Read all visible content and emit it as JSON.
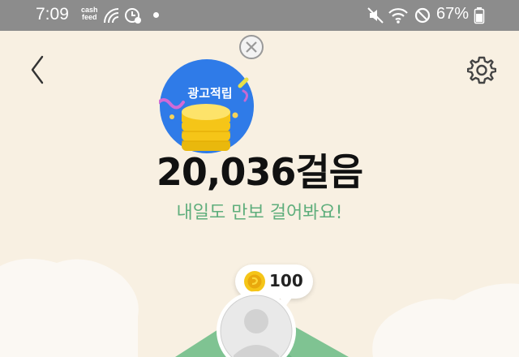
{
  "status_bar": {
    "time": "7:09",
    "cashfeed_top": "cash",
    "cashfeed_bottom": "feed",
    "battery": "67%"
  },
  "header": {
    "back_icon": "chevron-left-icon",
    "settings_icon": "gear-icon",
    "close_icon": "close-circle-icon"
  },
  "ad_badge": {
    "label": "광고적립"
  },
  "steps": {
    "count_text": "20,036걸음",
    "message": "내일도 만보 걸어봐요!"
  },
  "reward": {
    "amount": "100",
    "icon": "coin-icon"
  },
  "colors": {
    "background": "#f8f0e2",
    "accent_green": "#5fae7c",
    "badge_blue": "#2f7be8",
    "coin_yellow": "#f5c518"
  }
}
